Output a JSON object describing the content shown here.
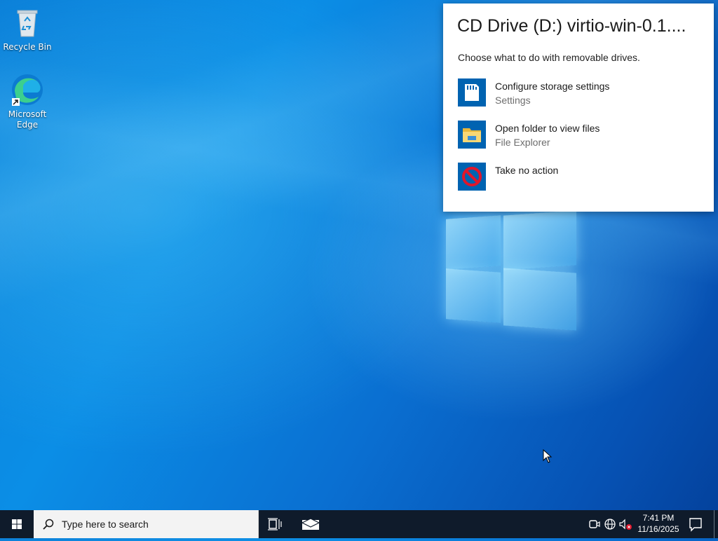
{
  "desktop": {
    "icons": [
      {
        "label": "Recycle Bin",
        "icon": "recycle-bin-icon"
      },
      {
        "label": "Microsoft Edge",
        "icon": "edge-icon"
      }
    ]
  },
  "autoplay": {
    "title": "CD Drive (D:) virtio-win-0.1....",
    "subtitle": "Choose what to do with removable drives.",
    "options": [
      {
        "label": "Configure storage settings",
        "sublabel": "Settings",
        "icon": "sd-card-icon"
      },
      {
        "label": "Open folder to view files",
        "sublabel": "File Explorer",
        "icon": "folder-icon"
      },
      {
        "label": "Take no action",
        "sublabel": "",
        "icon": "no-action-icon"
      }
    ],
    "accent": "#0063b1"
  },
  "taskbar": {
    "search_placeholder": "Type here to search",
    "time": "7:41 PM",
    "date": "11/16/2025",
    "background": "#0f1b2b"
  }
}
